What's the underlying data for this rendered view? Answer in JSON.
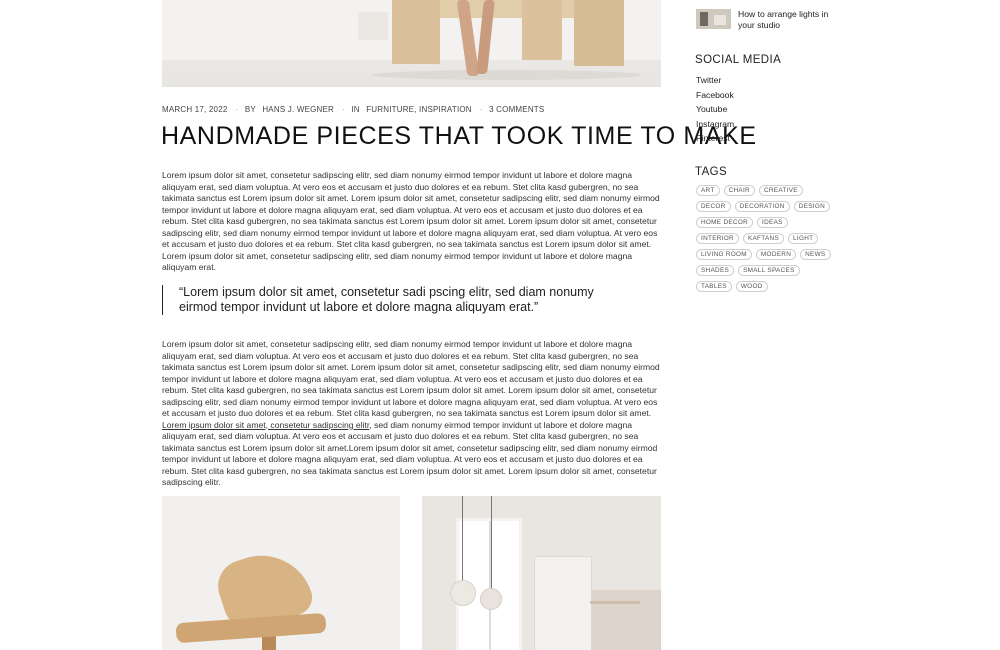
{
  "post": {
    "date": "MARCH 17, 2022",
    "author_prefix": "BY",
    "author": "HANS J. WEGNER",
    "category_prefix": "IN",
    "categories": "FURNITURE, INSPIRATION",
    "comments": "3 COMMENTS",
    "title": "HANDMADE PIECES THAT TOOK TIME TO MAKE",
    "paragraph1": "Lorem ipsum dolor sit amet, consetetur sadipscing elitr, sed diam nonumy eirmod tempor invidunt ut labore et dolore magna aliquyam erat, sed diam voluptua. At vero eos et accusam et justo duo dolores et ea rebum. Stet clita kasd gubergren, no sea takimata sanctus est Lorem ipsum dolor sit amet. Lorem ipsum dolor sit amet, consetetur sadipscing elitr, sed diam nonumy eirmod tempor invidunt ut labore et dolore magna aliquyam erat, sed diam voluptua. At vero eos et accusam et justo duo dolores et ea rebum. Stet clita kasd gubergren, no sea takimata sanctus est Lorem ipsum dolor sit amet. Lorem ipsum dolor sit amet, consetetur sadipscing elitr, sed diam nonumy eirmod tempor invidunt ut labore et dolore magna aliquyam erat, sed diam voluptua. At vero eos et accusam et justo duo dolores et ea rebum. Stet clita kasd gubergren, no sea takimata sanctus est Lorem ipsum dolor sit amet. Lorem ipsum dolor sit amet, consetetur sadipscing elitr, sed diam nonumy eirmod tempor invidunt ut labore et dolore magna aliquyam erat.",
    "quote": "“Lorem ipsum dolor sit amet, consetetur sadi pscing elitr, sed diam nonumy eirmod tempor invidunt ut labore et dolore magna aliquyam erat.”",
    "paragraph2_before": "Lorem ipsum dolor sit amet, consetetur sadipscing elitr, sed diam nonumy eirmod tempor invidunt ut labore et dolore magna aliquyam erat, sed diam voluptua. At vero eos et accusam et justo duo dolores et ea rebum. Stet clita kasd gubergren, no sea takimata sanctus est Lorem ipsum dolor sit amet. Lorem ipsum dolor sit amet, consetetur sadipscing elitr, sed diam nonumy eirmod tempor invidunt ut labore et dolore magna aliquyam erat, sed diam voluptua. At vero eos et accusam et justo duo dolores et ea rebum. Stet clita kasd gubergren, no sea takimata sanctus est Lorem ipsum dolor sit amet. Lorem ipsum dolor sit amet, consetetur sadipscing elitr, sed diam nonumy eirmod tempor invidunt ut labore et dolore magna aliquyam erat, sed diam voluptua. At vero eos et accusam et justo duo dolores et ea rebum. Stet clita kasd gubergren, no sea takimata sanctus est Lorem ipsum dolor sit amet. ",
    "paragraph2_link": "Lorem ipsum dolor sit amet, consetetur sadipscing elitr",
    "paragraph2_after": ", sed diam nonumy eirmod tempor invidunt ut labore et dolore magna aliquyam erat, sed diam voluptua. At vero eos et accusam et justo duo dolores et ea rebum. Stet clita kasd gubergren, no sea takimata sanctus est Lorem ipsum dolor sit amet.Lorem ipsum dolor sit amet, consetetur sadipscing elitr, sed diam nonumy eirmod tempor invidunt ut labore et dolore magna aliquyam erat, sed diam voluptua. At vero eos et accusam et justo duo dolores et ea rebum. Stet clita kasd gubergren, no sea takimata sanctus est Lorem ipsum dolor sit amet. Lorem ipsum dolor sit amet, consetetur sadipscing elitr."
  },
  "sidebar": {
    "recent_post_title": "How to arrange lights in your studio",
    "social_heading": "SOCIAL MEDIA",
    "social_links": [
      "Twitter",
      "Facebook",
      "Youtube",
      "Instagram",
      "Pinterest"
    ],
    "tags_heading": "TAGS",
    "tags": [
      "ART",
      "CHAIR",
      "CREATIVE",
      "DECOR",
      "DECORATION",
      "DESIGN",
      "HOME DECOR",
      "IDEAS",
      "INTERIOR",
      "KAFTANS",
      "LIGHT",
      "LIVING ROOM",
      "MODERN",
      "NEWS",
      "SHADES",
      "SMALL SPACES",
      "TABLES",
      "WOOD"
    ]
  }
}
